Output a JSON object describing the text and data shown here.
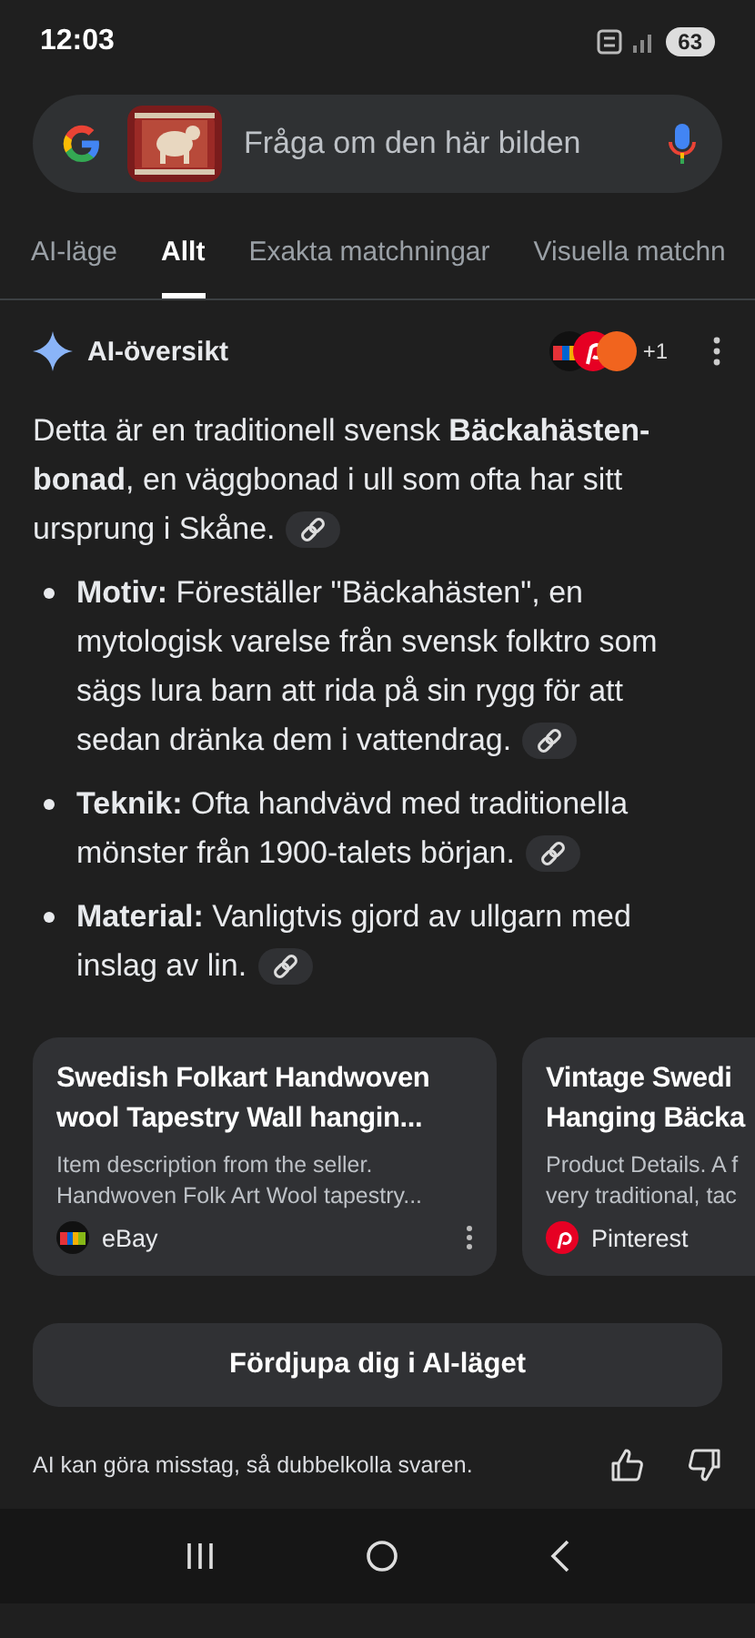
{
  "status_bar": {
    "time": "12:03",
    "battery": "63"
  },
  "search": {
    "placeholder": "Fråga om den här bilden"
  },
  "tabs": [
    {
      "label": "AI-läge",
      "selected": false
    },
    {
      "label": "Allt",
      "selected": true
    },
    {
      "label": "Exakta matchningar",
      "selected": false
    },
    {
      "label": "Visuella matchn",
      "selected": false
    }
  ],
  "overview": {
    "title": "AI-översikt",
    "source_count": "+1",
    "intro_lines": [
      "Detta är en traditionell svensk **Bäckahästen-**",
      "**bonad**, en väggbonad i ull som ofta har sitt",
      "ursprung i Skåne."
    ],
    "bullets": [
      {
        "lines": [
          "**Motiv:** Föreställer \"Bäckahästen\", en",
          "mytologisk varelse från svensk folktro som",
          "sägs lura barn att rida på sin rygg för att",
          "sedan dränka dem i vattendrag."
        ]
      },
      {
        "lines": [
          "**Teknik:** Ofta handvävd med traditionella",
          "mönster från 1900-talets början."
        ]
      },
      {
        "lines": [
          "**Material:** Vanligtvis gjord av ullgarn med",
          "inslag av lin."
        ]
      }
    ]
  },
  "cards": [
    {
      "title_lines": [
        "Swedish Folkart Handwoven",
        "wool Tapestry Wall hangin..."
      ],
      "snippet_lines": [
        "Item description from the seller.",
        "Handwoven Folk Art Wool tapestry..."
      ],
      "source": "eBay",
      "kind": "ebay"
    },
    {
      "title_lines": [
        "Vintage Swedi",
        "Hanging Bäcka"
      ],
      "snippet_lines": [
        "Product Details. A f",
        "very traditional, tac"
      ],
      "source": "Pinterest",
      "kind": "pinterest"
    }
  ],
  "deep_dive_button": "Fördjupa dig i AI-läget",
  "disclaimer": "AI kan göra misstag, så dubbelkolla svaren."
}
